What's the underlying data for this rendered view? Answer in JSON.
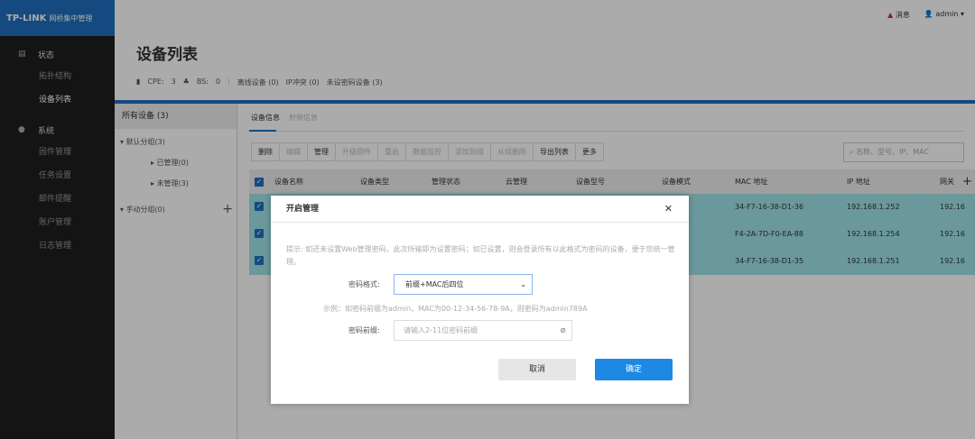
{
  "logo": {
    "brand": "TP-LINK",
    "product": "网桥集中管理"
  },
  "sidebar": {
    "sections": [
      {
        "label": "状态",
        "icon": "dashboard-icon",
        "items": [
          "拓扑结构",
          "设备列表"
        ]
      },
      {
        "label": "系统",
        "icon": "gear-icon",
        "items": [
          "固件管理",
          "任务设置",
          "邮件提醒",
          "账户管理",
          "日志管理"
        ]
      }
    ],
    "active": "设备列表"
  },
  "header": {
    "messages": "消息",
    "user": "admin"
  },
  "page": {
    "title": "设备列表",
    "stats": {
      "cpe_label": "CPE:",
      "cpe": "3",
      "bs_label": "BS:",
      "bs": "0",
      "offline": "离线设备 (0)",
      "ip_conflict": "IP冲突 (0)",
      "no_pwd": "未设密码设备 (3)"
    }
  },
  "tree": {
    "all": "所有设备 (3)",
    "default": "默认分组(3)",
    "managed": "已管理(0)",
    "unmanaged": "未管理(3)",
    "manual": "手动分组(0)"
  },
  "tabs": [
    "设备信息",
    "射频信息"
  ],
  "toolbar": [
    {
      "label": "删除",
      "enabled": true
    },
    {
      "label": "编辑",
      "enabled": false
    },
    {
      "label": "管理",
      "enabled": true
    },
    {
      "label": "升级固件",
      "enabled": false
    },
    {
      "label": "重启",
      "enabled": false
    },
    {
      "label": "数据监控",
      "enabled": false
    },
    {
      "label": "添加到组",
      "enabled": false
    },
    {
      "label": "从组删除",
      "enabled": false
    },
    {
      "label": "导出列表",
      "enabled": true
    },
    {
      "label": "更多",
      "enabled": true
    }
  ],
  "search": {
    "placeholder": "名称、型号、IP、MAC"
  },
  "table": {
    "columns": [
      "设备名称",
      "设备类型",
      "管理状态",
      "云管理",
      "设备型号",
      "设备模式",
      "MAC 地址",
      "IP 地址",
      "网关"
    ],
    "rows": [
      {
        "mac": "34-F7-16-38-D1-36",
        "ip": "192.168.1.252",
        "gw": "192.16"
      },
      {
        "mac": "F4-2A-7D-F0-EA-88",
        "ip": "192.168.1.254",
        "gw": "192.16"
      },
      {
        "mac": "34-F7-16-38-D1-35",
        "ip": "192.168.1.251",
        "gw": "192.16"
      }
    ]
  },
  "modal": {
    "title": "开启管理",
    "hint": "提示: 如还未设置Web管理密码，此次所输即为设置密码；如已设置，则会登录所有以此格式为密码的设备，便于您统一管理。",
    "format_label": "密码格式:",
    "format_value": "前缀+MAC后四位",
    "example": "示例：如密码前缀为admin，MAC为00-12-34-56-78-9A，则密码为admin789A",
    "prefix_label": "密码前缀:",
    "prefix_placeholder": "请输入2-11位密码前缀",
    "cancel": "取消",
    "ok": "确定"
  },
  "colors": {
    "brand": "#1f6fbf",
    "primary_button": "#1e88e5",
    "row_selected": "#9fe3e8"
  }
}
